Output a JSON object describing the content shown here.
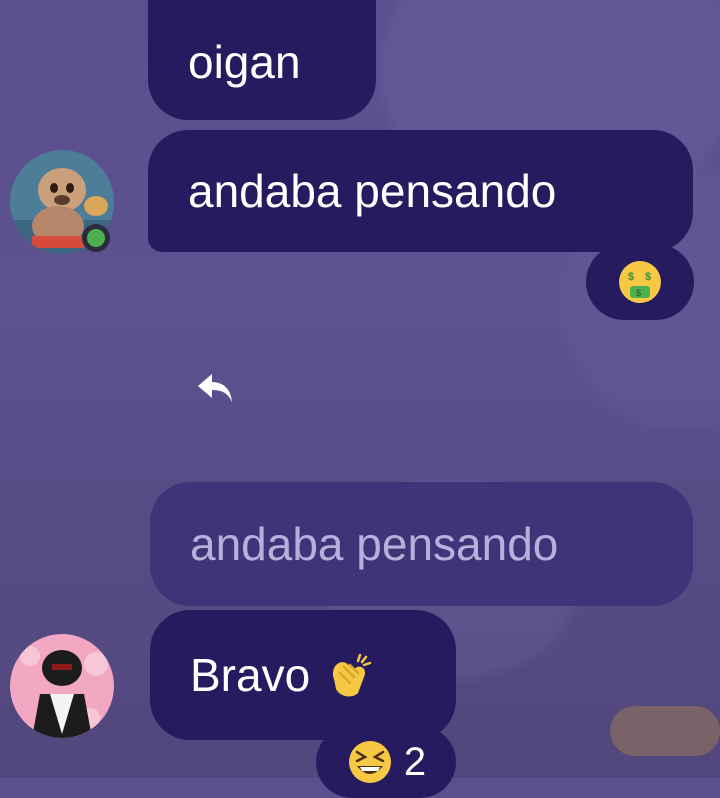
{
  "messages": [
    {
      "text": "oigan"
    },
    {
      "text": "andaba pensando"
    }
  ],
  "reaction_top": {
    "emoji": "money-mouth-face"
  },
  "reply_icon": "reply-arrow-icon",
  "reply_quote": {
    "text": "andaba pensando"
  },
  "reply_message": {
    "text": "Bravo"
  },
  "reaction_bottom": {
    "emoji": "grinning-squinting-face",
    "count": "2"
  },
  "colors": {
    "bubble": "#251b5e",
    "reply_bubble": "#3e3478",
    "background": "#5b4f8d",
    "online_badge": "#4caf50"
  }
}
